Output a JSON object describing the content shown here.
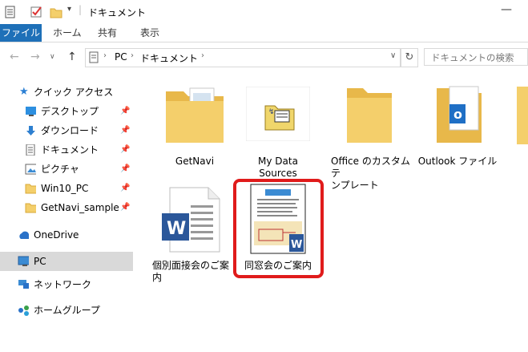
{
  "title": "ドキュメント",
  "ribbon": {
    "tabs": [
      "ファイル",
      "ホーム",
      "共有",
      "表示"
    ]
  },
  "address": {
    "crumbs": [
      "PC",
      "ドキュメント"
    ],
    "search_placeholder": "ドキュメントの検索"
  },
  "sidebar": {
    "quick_access": "クイック アクセス",
    "items": [
      {
        "label": "デスクトップ",
        "icon": "desktop-icon"
      },
      {
        "label": "ダウンロード",
        "icon": "download-icon"
      },
      {
        "label": "ドキュメント",
        "icon": "document-icon"
      },
      {
        "label": "ピクチャ",
        "icon": "picture-icon"
      },
      {
        "label": "Win10_PC",
        "icon": "folder-icon"
      },
      {
        "label": "GetNavi_sample",
        "icon": "folder-icon"
      }
    ],
    "onedrive": "OneDrive",
    "pc": "PC",
    "network": "ネットワーク",
    "homegroup": "ホームグループ"
  },
  "files": [
    {
      "name": "GetNavi",
      "type": "folder"
    },
    {
      "name": "My Data Sources",
      "type": "folder"
    },
    {
      "name_line1": "Office のカスタム テ",
      "name_line2": "ンプレート",
      "type": "folder"
    },
    {
      "name": "Outlook ファイル",
      "type": "folder"
    },
    {
      "name_line1": "個別面接会のご案",
      "name_line2": "内",
      "type": "word"
    },
    {
      "name": "同窓会のご案内",
      "type": "word",
      "selected": true
    }
  ],
  "colors": {
    "accent": "#1e70b8",
    "folder": "#f4cf6b",
    "word": "#2b579a",
    "highlight": "#e01b1b"
  }
}
